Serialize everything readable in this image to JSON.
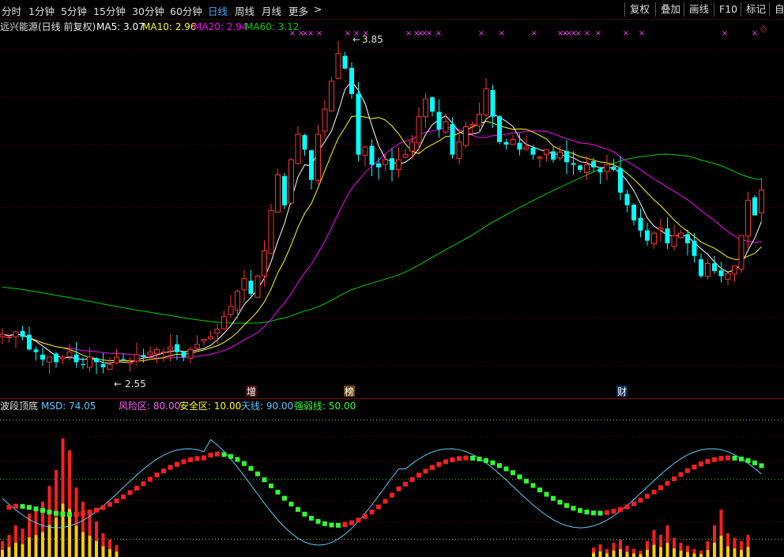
{
  "toolbar": {
    "periods": [
      "分时",
      "1分钟",
      "5分钟",
      "15分钟",
      "30分钟",
      "60分钟",
      "日线",
      "周线",
      "月线",
      "更多"
    ],
    "more_arrow": ">",
    "active_period": "日线",
    "buttons": [
      "复权",
      "叠加",
      "画线",
      "F10",
      "标记",
      "自"
    ]
  },
  "main_chart": {
    "name": "远兴能源(日线 前复权)",
    "ma5_label": "MA5: 3.07",
    "ma10_label": "MA10: 2.96",
    "ma20_label": "MA20: 2.94",
    "ma60_label": "MA60: 3.12",
    "high_label": "3.85",
    "low_label": "2.55",
    "event_markers": [
      "增",
      "榜",
      "财"
    ],
    "signal_mark": "×",
    "diamond_mark": "◇",
    "colors": {
      "up": "#ff3232",
      "down": "#00ffff",
      "ma5": "#ffffff",
      "ma10": "#ffff00",
      "ma20": "#ff00ff",
      "ma60": "#00d000",
      "grid": "#6a0000"
    }
  },
  "indicator": {
    "name": "波段顶底",
    "msd_label": "MSD: 74.05",
    "risk_label": "风险区: 80.00",
    "safe_label": "安全区: 10.00",
    "sky_label": "天线: 90.00",
    "strength_label": "强弱线: 50.00"
  },
  "chart_data": {
    "type": "candlestick",
    "period": "daily",
    "price_high_marker": 3.85,
    "price_low_marker": 2.55,
    "ma_latest": {
      "MA5": 3.07,
      "MA10": 2.96,
      "MA20": 2.94,
      "MA60": 3.12
    },
    "closes": [
      2.69,
      2.68,
      2.7,
      2.68,
      2.63,
      2.62,
      2.59,
      2.6,
      2.58,
      2.6,
      2.62,
      2.58,
      2.57,
      2.6,
      2.58,
      2.56,
      2.57,
      2.6,
      2.59,
      2.58,
      2.61,
      2.6,
      2.62,
      2.63,
      2.62,
      2.64,
      2.62,
      2.6,
      2.63,
      2.65,
      2.67,
      2.68,
      2.71,
      2.76,
      2.8,
      2.86,
      2.91,
      2.85,
      2.92,
      3.02,
      3.18,
      3.32,
      3.2,
      3.38,
      3.48,
      3.42,
      3.3,
      3.48,
      3.58,
      3.69,
      3.8,
      3.74,
      3.64,
      3.4,
      3.43,
      3.36,
      3.35,
      3.38,
      3.34,
      3.38,
      3.4,
      3.45,
      3.55,
      3.62,
      3.57,
      3.5,
      3.53,
      3.4,
      3.45,
      3.51,
      3.52,
      3.56,
      3.66,
      3.55,
      3.45,
      3.44,
      3.46,
      3.42,
      3.43,
      3.4,
      3.39,
      3.42,
      3.38,
      3.41,
      3.37,
      3.36,
      3.34,
      3.36,
      3.35,
      3.33,
      3.36,
      3.34,
      3.25,
      3.2,
      3.14,
      3.1,
      3.06,
      3.09,
      3.11,
      3.05,
      3.08,
      3.09,
      3.05,
      3.0,
      2.92,
      2.97,
      2.94,
      2.92,
      2.93,
      2.96,
      3.08,
      3.22,
      3.16,
      3.26
    ],
    "indicator_values": {
      "MSD": 74.05,
      "risk_zone": 80.0,
      "safe_zone": 10.0,
      "sky_line": 90.0,
      "strength_line": 50.0
    },
    "event_markers": [
      "增",
      "榜",
      "财"
    ]
  }
}
